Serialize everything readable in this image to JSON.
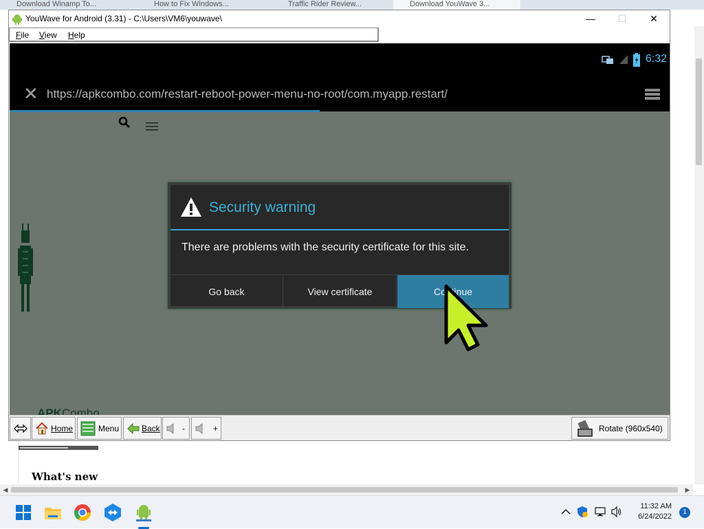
{
  "background_browser": {
    "tabs": [
      "Download Winamp To...",
      "How to Fix Windows...",
      "Traffic Rider Review...",
      "Download YouWave 3..."
    ],
    "whats_new": "What's new"
  },
  "window": {
    "title": "YouWave for Android (3.31) - C:\\Users\\VM6\\youwave\\",
    "controls": {
      "minimize": "—",
      "maximize": "☐",
      "close": "✕"
    }
  },
  "menubar": {
    "items": [
      {
        "label": "File",
        "accel": "F",
        "rest": "ile"
      },
      {
        "label": "View",
        "accel": "V",
        "rest": "iew"
      },
      {
        "label": "Help",
        "accel": "H",
        "rest": "elp"
      }
    ]
  },
  "android": {
    "clock": "6:32",
    "url": "https://apkcombo.com/restart-reboot-power-menu-no-root/com.myapp.restart/",
    "page_brand_bold": "APK",
    "page_brand_light": "Combo",
    "progress": 0.47
  },
  "dialog": {
    "title": "Security warning",
    "message": "There are problems with the security certificate for this site.",
    "buttons": {
      "back": "Go back",
      "view": "View certificate",
      "continue": "Continue"
    }
  },
  "toolbar": {
    "home": "Home",
    "menu": "Menu",
    "back": "Back",
    "vol_down": "-",
    "vol_up": "+",
    "rotate": "Rotate (960x540)"
  },
  "taskbar": {
    "time": "11:32 AM",
    "date": "6/24/2022",
    "notifications": "1"
  },
  "colors": {
    "accent": "#34a8d8",
    "continue_button": "#2e7ea4",
    "cursor": "#c8f02a"
  }
}
